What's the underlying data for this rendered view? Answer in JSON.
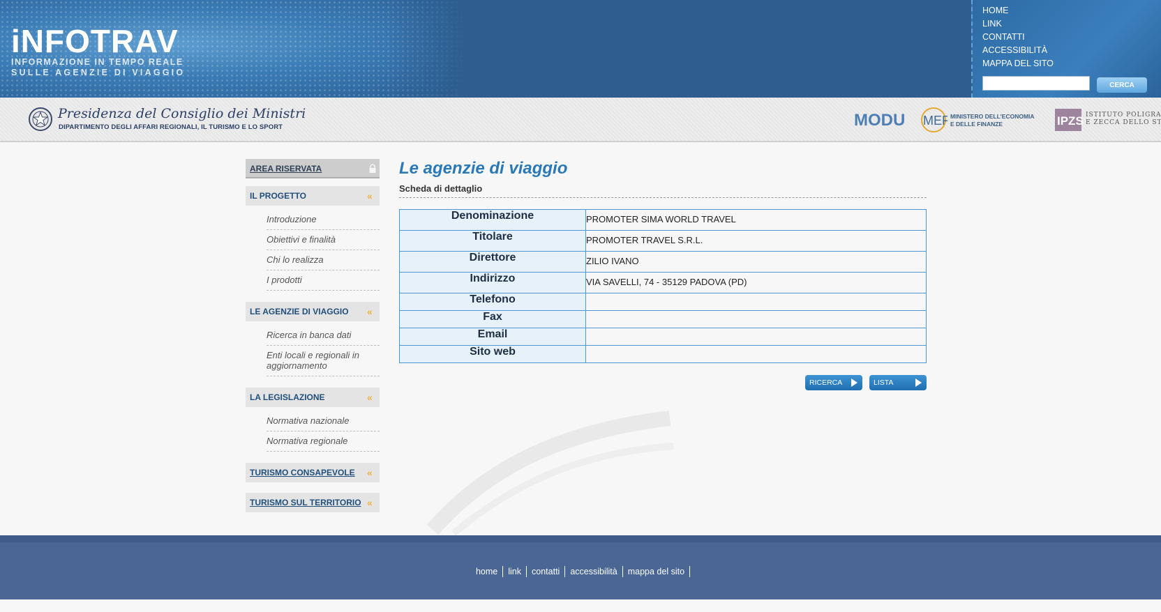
{
  "header": {
    "logo_main": "iNFOTRAV",
    "logo_sub_1": "INFORMAZIONE IN TEMPO REALE",
    "logo_sub_2": "SULLE AGENZIE DI VIAGGIO",
    "top_nav": [
      "HOME",
      "LINK",
      "CONTATTI",
      "ACCESSIBILITÀ",
      "MAPPA DEL SITO"
    ],
    "search_button": "CERCA",
    "search_value": ""
  },
  "sponsor_bar": {
    "presidenza_title": "Presidenza del Consiglio dei Ministri",
    "presidenza_sub": "DIPARTIMENTO DEGLI AFFARI REGIONALI, IL TURISMO E LO SPORT",
    "modus": "MODUS",
    "mef": "MEF",
    "mef_text_1": "MINISTERO DELL'ECONOMIA",
    "mef_text_2": "E DELLE FINANZE",
    "ipzs": "IPZS",
    "ipzs_text_1": "ISTITUTO POLIGRAFICO",
    "ipzs_text_2": "E ZECCA DELLO STATO"
  },
  "sidebar": {
    "area_riservata": "AREA RISERVATA",
    "progetto": {
      "title": "IL PROGETTO",
      "items": [
        "Introduzione",
        "Obiettivi e finalità",
        "Chi lo realizza",
        "I prodotti"
      ]
    },
    "agenzie": {
      "title": "LE AGENZIE DI VIAGGIO",
      "items": [
        "Ricerca in banca dati",
        "Enti locali e regionali in aggiornamento"
      ]
    },
    "legislazione": {
      "title": "LA LEGISLAZIONE",
      "items": [
        "Normativa nazionale",
        "Normativa regionale"
      ]
    },
    "turismo_consapevole": "TURISMO CONSAPEVOLE",
    "turismo_territorio": "TURISMO SUL TERRITORIO"
  },
  "main": {
    "title": "Le agenzie di viaggio",
    "subtitle": "Scheda di dettaglio",
    "rows": [
      {
        "label": "Denominazione",
        "value": "PROMOTER SIMA WORLD TRAVEL"
      },
      {
        "label": "Titolare",
        "value": "PROMOTER TRAVEL S.R.L."
      },
      {
        "label": "Direttore",
        "value": "ZILIO IVANO"
      },
      {
        "label": "Indirizzo",
        "value": "VIA SAVELLI, 74 - 35129 PADOVA (PD)"
      },
      {
        "label": "Telefono",
        "value": ""
      },
      {
        "label": "Fax",
        "value": ""
      },
      {
        "label": "Email",
        "value": ""
      },
      {
        "label": "Sito web",
        "value": ""
      }
    ],
    "btn_ricerca": "RICERCA",
    "btn_lista": "LISTA"
  },
  "footer": {
    "links": [
      "home",
      "link",
      "contatti",
      "accessibilità",
      "mappa del sito"
    ]
  },
  "colors": {
    "accent": "#2a79b6",
    "header_bg": "#2e5d8e",
    "footer_bg": "#4a6694",
    "sidebar_arrow": "#f3b23c"
  }
}
